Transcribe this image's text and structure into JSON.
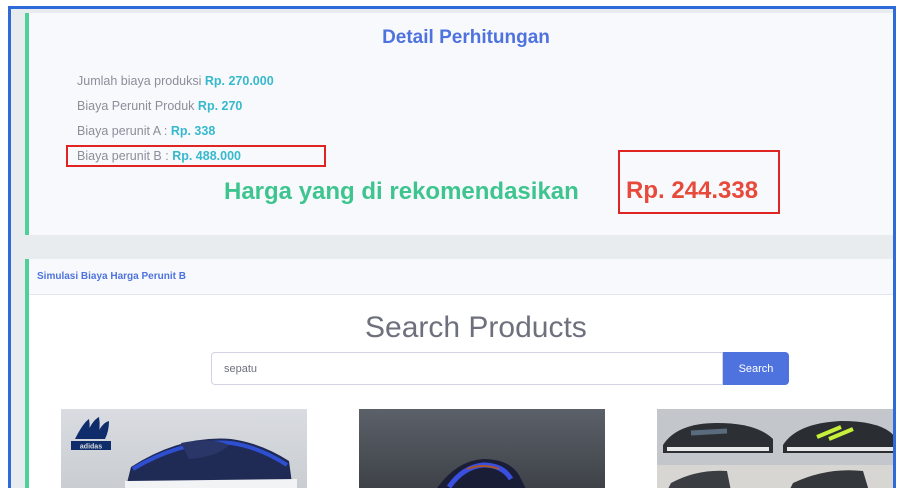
{
  "detail": {
    "title": "Detail Perhitungan",
    "lines": [
      {
        "label": "Jumlah biaya produksi",
        "value": "Rp. 270.000"
      },
      {
        "label": "Biaya Perunit Produk",
        "value": "Rp. 270"
      },
      {
        "label": "Biaya perunit A :",
        "value": "Rp. 338"
      },
      {
        "label": "Biaya perunit B :",
        "value": "Rp. 488.000"
      }
    ],
    "recommend_label": "Harga yang di rekomendasikan",
    "recommend_value": "Rp. 244.338"
  },
  "simulation": {
    "title": "Simulasi Biaya Harga Perunit B"
  },
  "search": {
    "title": "Search Products",
    "input_value": "sepatu",
    "button_label": "Search"
  },
  "products": [
    {
      "name": "adidas-shoe-image",
      "brand_text": "adidas"
    },
    {
      "name": "dark-shoe-image"
    },
    {
      "name": "multi-shoe-image"
    }
  ],
  "colors": {
    "frame": "#2f6bd8",
    "accent_green": "#3ec58f",
    "highlight_red": "#e02424",
    "primary_blue": "#4e73df",
    "value_teal": "#36b9cc"
  }
}
